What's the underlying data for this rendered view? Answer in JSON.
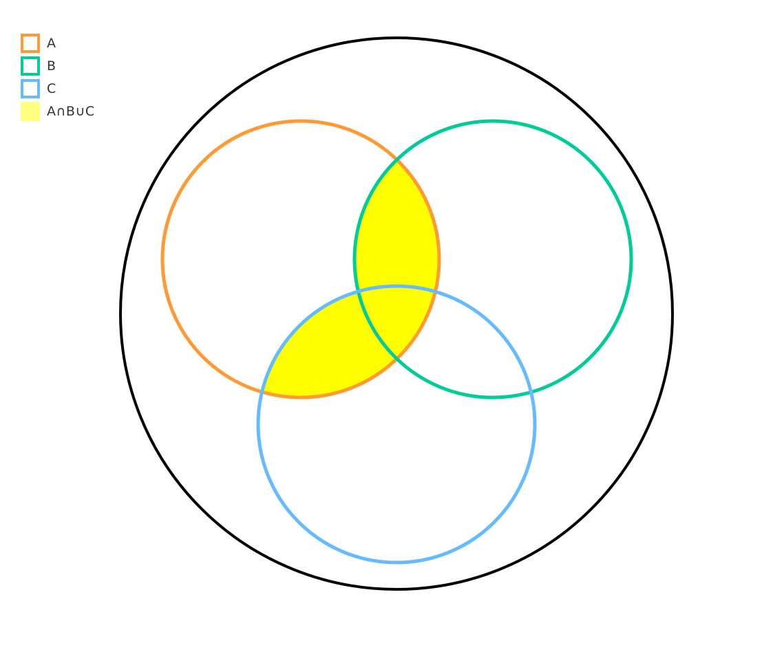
{
  "legend": {
    "items": [
      {
        "label": "A",
        "color": "#ff9933",
        "style": "outline"
      },
      {
        "label": "B",
        "color": "#00cc99",
        "style": "outline"
      },
      {
        "label": "C",
        "color": "#66bbff",
        "style": "outline"
      },
      {
        "label": "A∩B∪C",
        "color": "#ffff80",
        "style": "filled"
      }
    ]
  },
  "diagram": {
    "universe_color": "#000000",
    "highlight_color": "#ffff00",
    "sets": [
      {
        "label": "A",
        "color": "#ff9933"
      },
      {
        "label": "B",
        "color": "#00cc99"
      },
      {
        "label": "C",
        "color": "#66bbff"
      }
    ]
  }
}
